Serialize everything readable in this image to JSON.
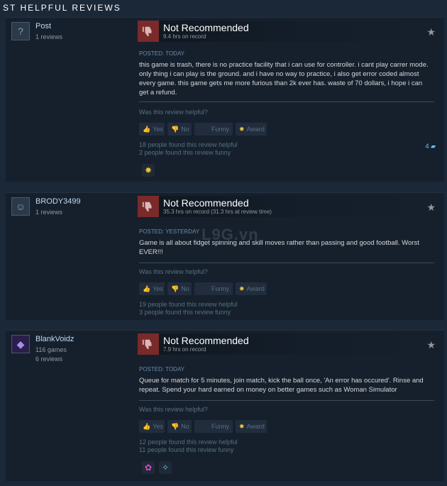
{
  "section_title": "ST HELPFUL REVIEWS",
  "watermark": "L9G.vn",
  "labels": {
    "helpful_q": "Was this review helpful?",
    "yes": "Yes",
    "no": "No",
    "funny": "Funny",
    "award": "Award"
  },
  "reviews": [
    {
      "author": "Post",
      "meta": [
        "1 reviews"
      ],
      "avatar_glyph": "?",
      "verdict": "Not Recommended",
      "hours": "9.4 hrs on record",
      "posted": "POSTED: TODAY",
      "text": "this game is trash, there is no practice facility that i can use for controller. i cant play carrer mode. only thing i can play is the ground. and i have no way to practice, i also get error coded almost every game. this game gets me more furious than 2k ever has. waste of 70 dollars, i hope i can get a refund.",
      "helpful": "18 people found this review helpful",
      "funny": "2 people found this review funny",
      "comments": "4",
      "awards": [
        "medal-award"
      ]
    },
    {
      "author": "BRODY3499",
      "meta": [
        "1 reviews"
      ],
      "avatar_glyph": "☺",
      "verdict": "Not Recommended",
      "hours": "35.3 hrs on record (31.3 hrs at review time)",
      "posted": "POSTED: YESTERDAY",
      "text": "Game is all about fidget spinning and skill moves rather than passing and good football. Worst EVER!!!",
      "helpful": "19 people found this review helpful",
      "funny": "3 people found this review funny"
    },
    {
      "author": "BlankVoidz",
      "meta": [
        "116 games",
        "6 reviews"
      ],
      "avatar_glyph": "◆",
      "verdict": "Not Recommended",
      "hours": "7.9 hrs on record",
      "posted": "POSTED: TODAY",
      "text": "Queue for match for 5 minutes, join match, kick the ball once, 'An error has occured'. Rinse and repeat. Spend your hard earned on money on better games such as Woman Simulator",
      "helpful": "12 people found this review helpful",
      "funny": "11 people found this review funny",
      "awards": [
        "flower-award",
        "sparkle-award"
      ]
    }
  ],
  "colors": {
    "background": "#1b2838",
    "card": "#16202d",
    "thumb_down": "#7a2a2a",
    "link": "#66c0f4"
  }
}
